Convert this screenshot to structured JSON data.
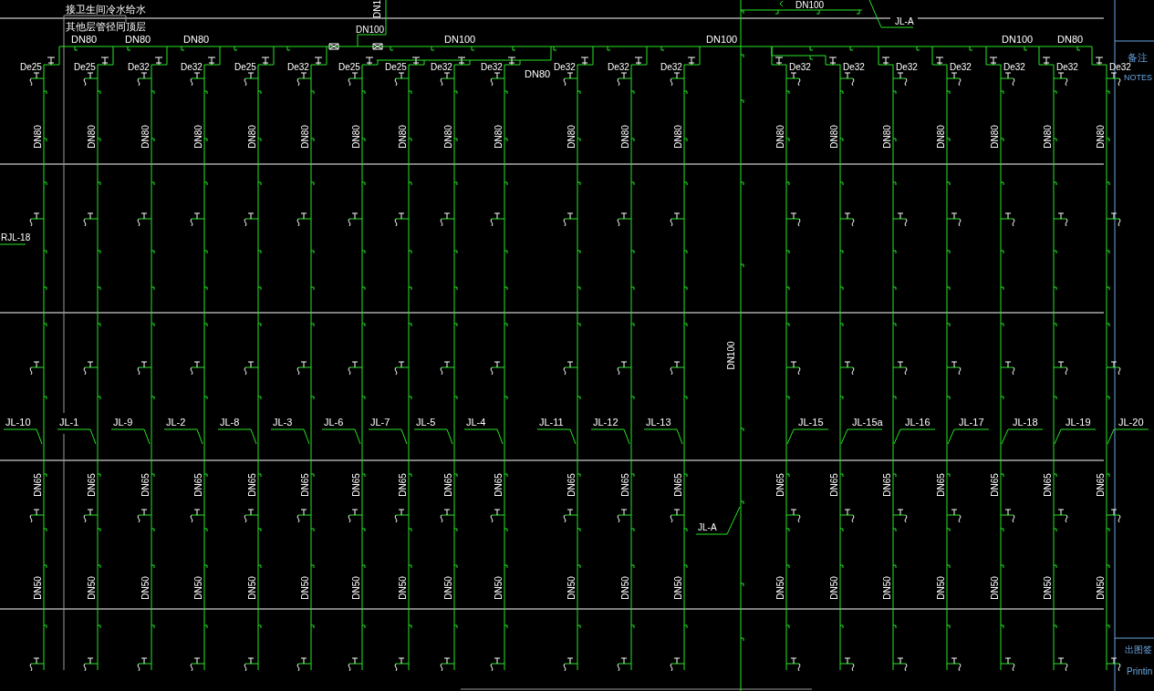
{
  "notes": [
    "接卫生间冷水给水",
    "其他层管径同顶层"
  ],
  "feed": {
    "vertical_size": "DN1",
    "size": "DN100"
  },
  "main_riser": {
    "top_size": "DN100",
    "top_tag": "JL-A",
    "size": "DN100",
    "tag": "JL-A"
  },
  "main_pipe_labels": [
    "DN80",
    "DN80",
    "DN80",
    "DN100",
    "DN80",
    "DN100",
    "DN100",
    "DN80"
  ],
  "side_tag": "RJL-18",
  "risers": [
    {
      "branch_size": "De25",
      "upper_size": "DN80",
      "middle_size": "DN65",
      "lower_size": "DN50",
      "tag": "JL-10"
    },
    {
      "branch_size": "De25",
      "upper_size": "DN80",
      "middle_size": "DN65",
      "lower_size": "DN50",
      "tag": "JL-1"
    },
    {
      "branch_size": "De32",
      "upper_size": "DN80",
      "middle_size": "DN65",
      "lower_size": "DN50",
      "tag": "JL-9"
    },
    {
      "branch_size": "De32",
      "upper_size": "DN80",
      "middle_size": "DN65",
      "lower_size": "DN50",
      "tag": "JL-2"
    },
    {
      "branch_size": "De25",
      "upper_size": "DN80",
      "middle_size": "DN65",
      "lower_size": "DN50",
      "tag": "JL-8"
    },
    {
      "branch_size": "De32",
      "upper_size": "DN80",
      "middle_size": "DN65",
      "lower_size": "DN50",
      "tag": "JL-3"
    },
    {
      "branch_size": "De25",
      "upper_size": "DN80",
      "middle_size": "DN65",
      "lower_size": "DN50",
      "tag": "JL-6"
    },
    {
      "branch_size": "De25",
      "upper_size": "DN80",
      "middle_size": "DN65",
      "lower_size": "DN50",
      "tag": "JL-7"
    },
    {
      "branch_size": "De32",
      "upper_size": "DN80",
      "middle_size": "DN65",
      "lower_size": "DN50",
      "tag": "JL-5"
    },
    {
      "branch_size": "De32",
      "upper_size": "DN80",
      "middle_size": "DN65",
      "lower_size": "DN50",
      "tag": "JL-4"
    },
    {
      "branch_size": "De32",
      "upper_size": "DN80",
      "middle_size": "DN65",
      "lower_size": "DN50",
      "tag": "JL-11"
    },
    {
      "branch_size": "De32",
      "upper_size": "DN80",
      "middle_size": "DN65",
      "lower_size": "DN50",
      "tag": "JL-12"
    },
    {
      "branch_size": "De32",
      "upper_size": "DN80",
      "middle_size": "DN65",
      "lower_size": "DN50",
      "tag": "JL-13"
    },
    {
      "branch_size": "De32",
      "upper_size": "DN80",
      "middle_size": "DN65",
      "lower_size": "DN50",
      "tag": "JL-15"
    },
    {
      "branch_size": "De32",
      "upper_size": "DN80",
      "middle_size": "DN65",
      "lower_size": "DN50",
      "tag": "JL-15a"
    },
    {
      "branch_size": "De32",
      "upper_size": "DN80",
      "middle_size": "DN65",
      "lower_size": "DN50",
      "tag": "JL-16"
    },
    {
      "branch_size": "De32",
      "upper_size": "DN80",
      "middle_size": "DN65",
      "lower_size": "DN50",
      "tag": "JL-17"
    },
    {
      "branch_size": "De32",
      "upper_size": "DN80",
      "middle_size": "DN65",
      "lower_size": "DN50",
      "tag": "JL-18"
    },
    {
      "branch_size": "De32",
      "upper_size": "DN80",
      "middle_size": "DN65",
      "lower_size": "DN50",
      "tag": "JL-19"
    },
    {
      "branch_size": "De32",
      "upper_size": "DN80",
      "middle_size": "DN65",
      "lower_size": "DN50",
      "tag": "JL-20"
    }
  ],
  "title_block": {
    "notes_cn": "备注",
    "notes_en": "NOTES",
    "stamp_cn": "出图签",
    "stamp_en": "Printin"
  }
}
